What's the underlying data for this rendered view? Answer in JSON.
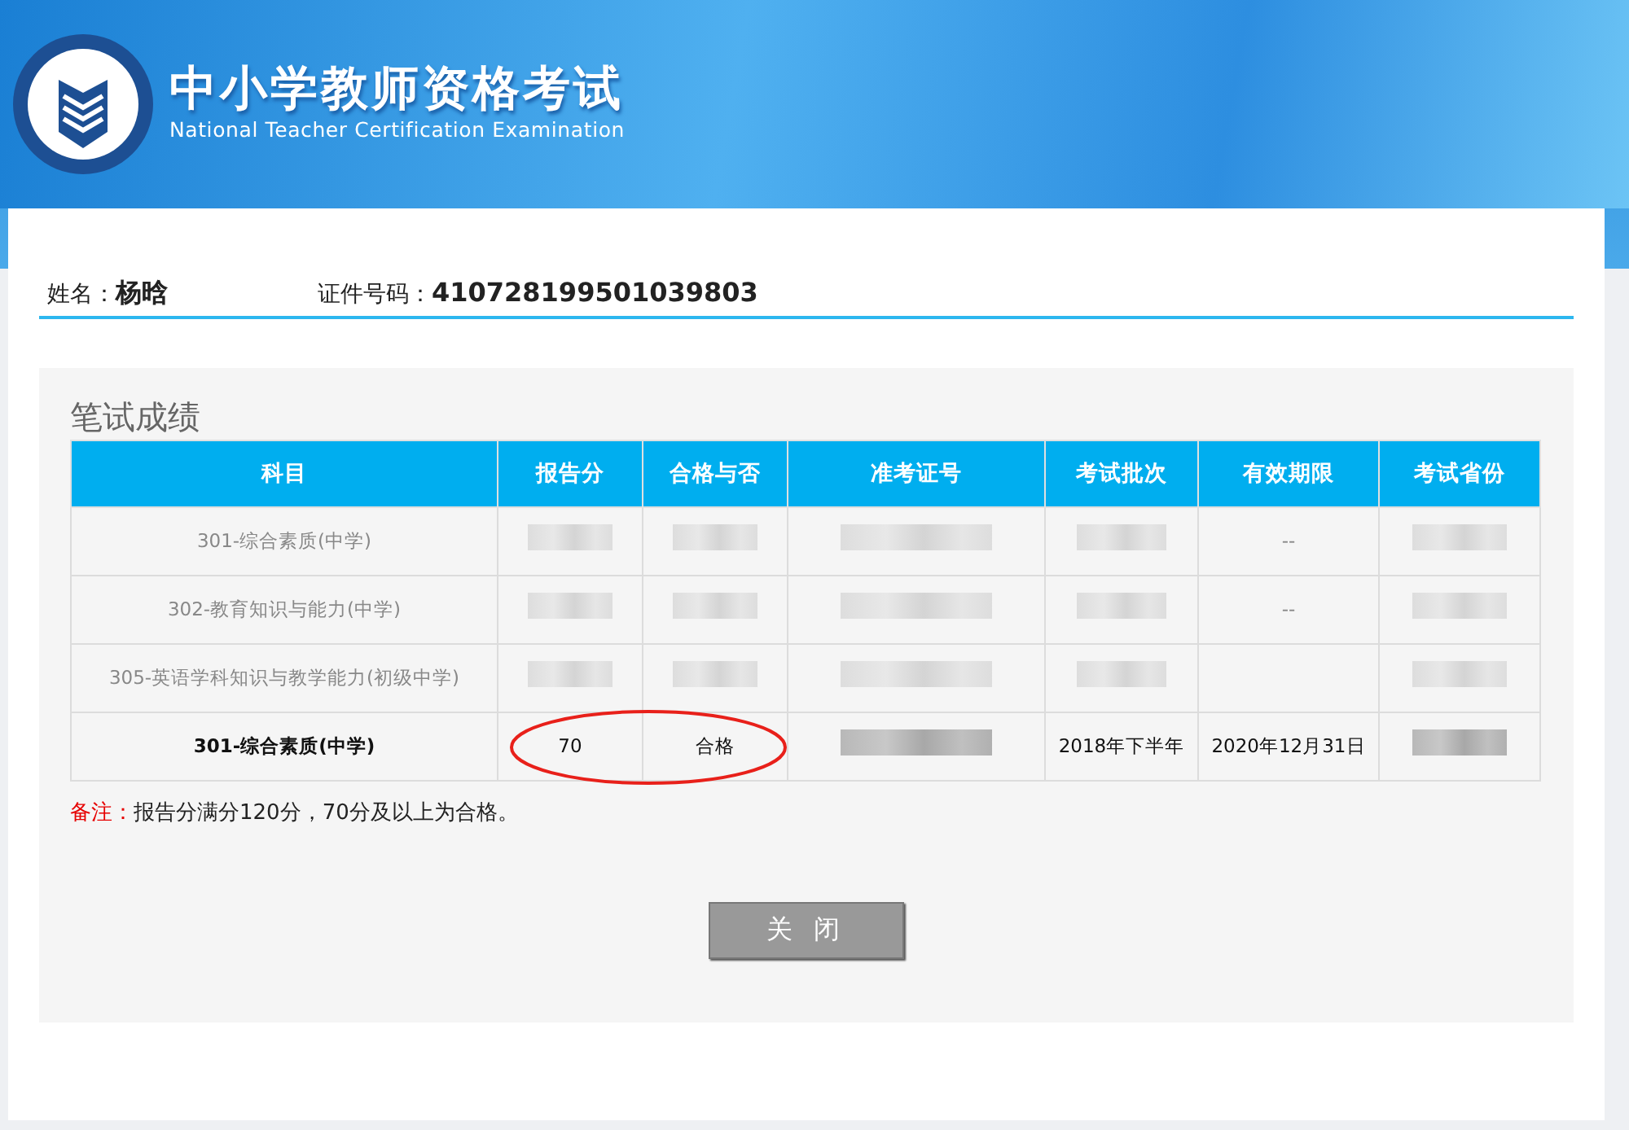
{
  "header": {
    "title": "中小学教师资格考试",
    "subtitle": "National Teacher Certification Examination"
  },
  "person": {
    "name_label": "姓名：",
    "name": "杨晗",
    "id_label": "证件号码：",
    "id_number": "410728199501039803"
  },
  "section_title": "笔试成绩",
  "table": {
    "columns": [
      "科目",
      "报告分",
      "合格与否",
      "准考证号",
      "考试批次",
      "有效期限",
      "考试省份"
    ],
    "rows": [
      {
        "current": false,
        "circled": false,
        "cells": [
          {
            "text": "301-综合素质(中学)"
          },
          {
            "redacted": true
          },
          {
            "redacted": true
          },
          {
            "redacted": true
          },
          {
            "redacted": true
          },
          {
            "text": "--"
          },
          {
            "redacted": true
          }
        ]
      },
      {
        "current": false,
        "circled": false,
        "cells": [
          {
            "text": "302-教育知识与能力(中学)"
          },
          {
            "redacted": true
          },
          {
            "redacted": true
          },
          {
            "redacted": true
          },
          {
            "redacted": true
          },
          {
            "text": "--"
          },
          {
            "redacted": true
          }
        ]
      },
      {
        "current": false,
        "circled": false,
        "cells": [
          {
            "text": "305-英语学科知识与教学能力(初级中学)"
          },
          {
            "redacted": true
          },
          {
            "redacted": true
          },
          {
            "redacted": true
          },
          {
            "redacted": true
          },
          {},
          {
            "redacted": true
          }
        ]
      },
      {
        "current": true,
        "circled": true,
        "cells": [
          {
            "text": "301-综合素质(中学)"
          },
          {
            "text": "70"
          },
          {
            "text": "合格"
          },
          {
            "redacted": true
          },
          {
            "text": "2018年下半年"
          },
          {
            "text": "2020年12月31日"
          },
          {
            "redacted": true
          }
        ]
      }
    ]
  },
  "note": {
    "label": "备注：",
    "text": "报告分满分120分，70分及以上为合格。"
  },
  "close_button": "关 闭"
}
